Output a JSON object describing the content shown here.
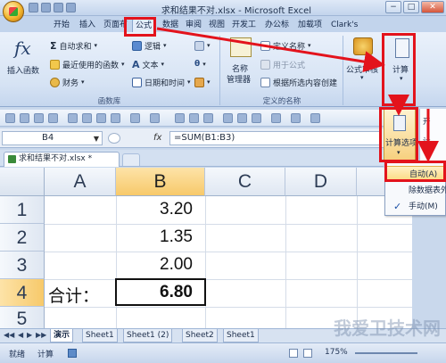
{
  "window": {
    "title": "求和结果不对.xlsx - Microsoft Excel",
    "min": "−",
    "max": "□",
    "close": "✕"
  },
  "tabs": [
    "开始",
    "插入",
    "页面布",
    "公式",
    "数据",
    "审阅",
    "视图",
    "开发工",
    "办公标",
    "加载项",
    "Clark's"
  ],
  "active_tab": "公式",
  "ribbon": {
    "insert_function": "插入函数",
    "autosum": "自动求和",
    "recent": "最近使用的函数",
    "financial": "财务",
    "logical": "逻辑",
    "text": "文本",
    "datetime": "日期和时间",
    "group_function_library": "函数库",
    "name_manager_1": "名称",
    "name_manager_2": "管理器",
    "define_name": "定义名称",
    "use_in_formula": "用于公式",
    "create_from_selection": "根据所选内容创建",
    "group_defined_names": "定义的名称",
    "formula_auditing": "公式审核",
    "calculation": "计算"
  },
  "formula_bar": {
    "name_box": "B4",
    "fx": "fx",
    "formula": "=SUM(B1:B3)"
  },
  "document_tab": "求和结果不对.xlsx *",
  "grid": {
    "columns": [
      "A",
      "B",
      "C",
      "D"
    ],
    "selected_column": "B",
    "rows": [
      "1",
      "2",
      "3",
      "4",
      "5"
    ],
    "selected_row": "4",
    "cells": {
      "B1": "3.20",
      "B2": "1.35",
      "B3": "2.00",
      "A4": "合计：",
      "B4": "6.80"
    }
  },
  "calc_menu": {
    "button_label": "计算选项",
    "side_items": [
      "开",
      "计"
    ],
    "items": [
      {
        "label": "自动(A)",
        "checked": false,
        "hover": true
      },
      {
        "label": "除数据表外",
        "checked": false,
        "hover": false
      },
      {
        "label": "手动(M)",
        "checked": true,
        "hover": false
      }
    ]
  },
  "sheet_tabs": {
    "nav": [
      "◀◀",
      "◀",
      "▶",
      "▶▶"
    ],
    "tabs": [
      "演示",
      "Sheet1",
      "Sheet1 (2)",
      "Sheet2",
      "Sheet1"
    ],
    "active": "演示"
  },
  "status": {
    "ready": "就绪",
    "calculate": "计算",
    "zoom": "175%"
  },
  "watermark": "我爱卫技术网",
  "colors": {
    "annotation_red": "#e3131c",
    "selection_orange": "#f7c96a",
    "ribbon_blue": "#d6e3f4"
  }
}
